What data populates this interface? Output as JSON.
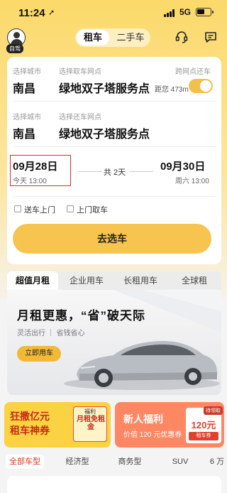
{
  "status_bar": {
    "time": "11:24",
    "network": "5G"
  },
  "header": {
    "avatar_badge": "自驾",
    "segment": {
      "active": "租车",
      "inactive": "二手车"
    }
  },
  "booking": {
    "pickup_city_label": "选择城市",
    "pickup_point_label": "选择取车网点",
    "cross_point_label": "跨网点还车",
    "pickup_city": "南昌",
    "pickup_point": "绿地双子塔服务点",
    "distance": "距您 473m",
    "return_city_label": "选择城市",
    "return_point_label": "选择还车网点",
    "return_city": "南昌",
    "return_point": "绿地双子塔服务点",
    "pickup_date": "09月28日",
    "pickup_time": "今天 13:00",
    "duration": "共 2天",
    "return_date": "09月30日",
    "return_time": "周六 13:00",
    "option_delivery": "送车上门",
    "option_pickup": "上门取车",
    "submit": "去选车"
  },
  "tabs": [
    "超值月租",
    "企业用车",
    "长租用车",
    "全球租"
  ],
  "banner": {
    "title": "月租更惠，“省”破天际",
    "subtitle": "灵活出行 ｜ 省钱省心",
    "button": "立即用车"
  },
  "promos": {
    "left_title_line1": "狂撒亿元",
    "left_title_line2": "租车神券",
    "left_tag": "福利",
    "left_tag_text": "月租免租金",
    "right_title": "新人福利",
    "right_sub": "价值 120 元优惠券",
    "coupon_badge": "待领取",
    "coupon_amount": "120元",
    "coupon_name": "租车券"
  },
  "filters": [
    "全部车型",
    "经济型",
    "商务型",
    "SUV",
    "6 万"
  ],
  "colors": {
    "accent": "#f6c44f",
    "highlight": "#d9302a"
  }
}
